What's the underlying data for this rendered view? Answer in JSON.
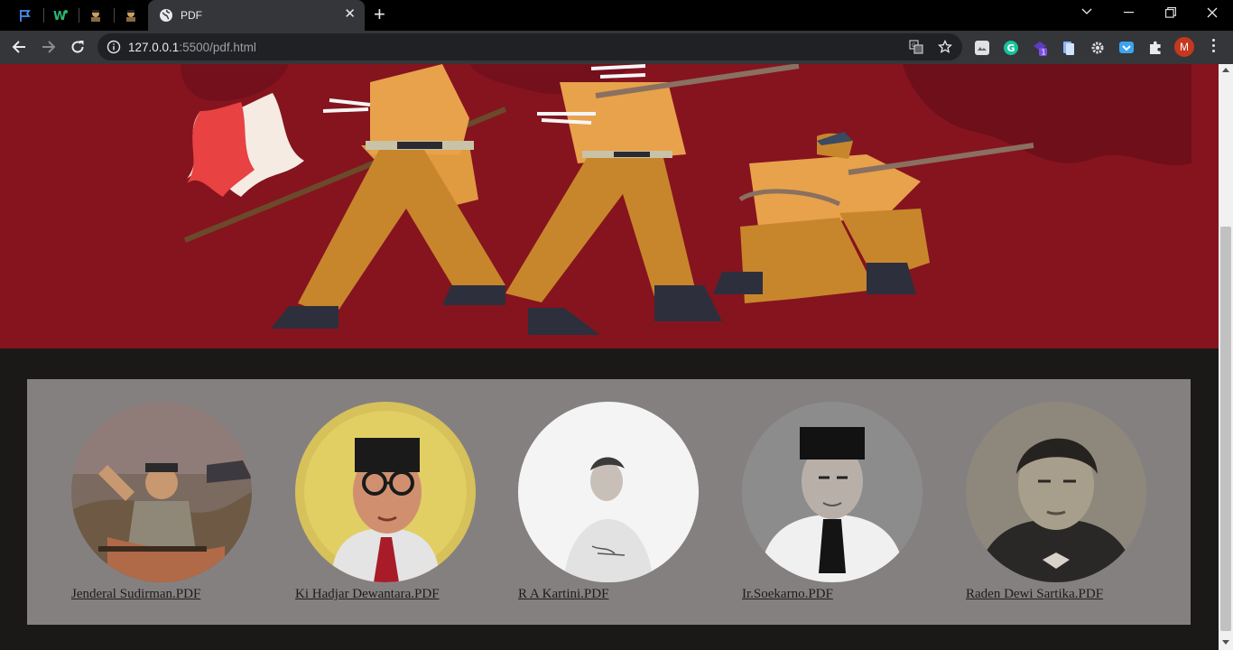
{
  "browser": {
    "active_tab_title": "PDF",
    "url_host": "127.0.0.1",
    "url_rest": ":5500/pdf.html",
    "profile_initial": "M",
    "extension_badge": "1"
  },
  "colors": {
    "hero_background": "#85141f",
    "panel_background": "#858080",
    "page_background": "#1b1918"
  },
  "hero": {
    "illustration": "freedom-fighters-with-flag-illustration"
  },
  "pdfs": [
    {
      "label": "Jenderal Sudirman.PDF"
    },
    {
      "label": "Ki Hadjar Dewantara.PDF"
    },
    {
      "label": "R A Kartini.PDF"
    },
    {
      "label": "Ir.Soekarno.PDF"
    },
    {
      "label": "Raden Dewi Sartika.PDF"
    }
  ]
}
